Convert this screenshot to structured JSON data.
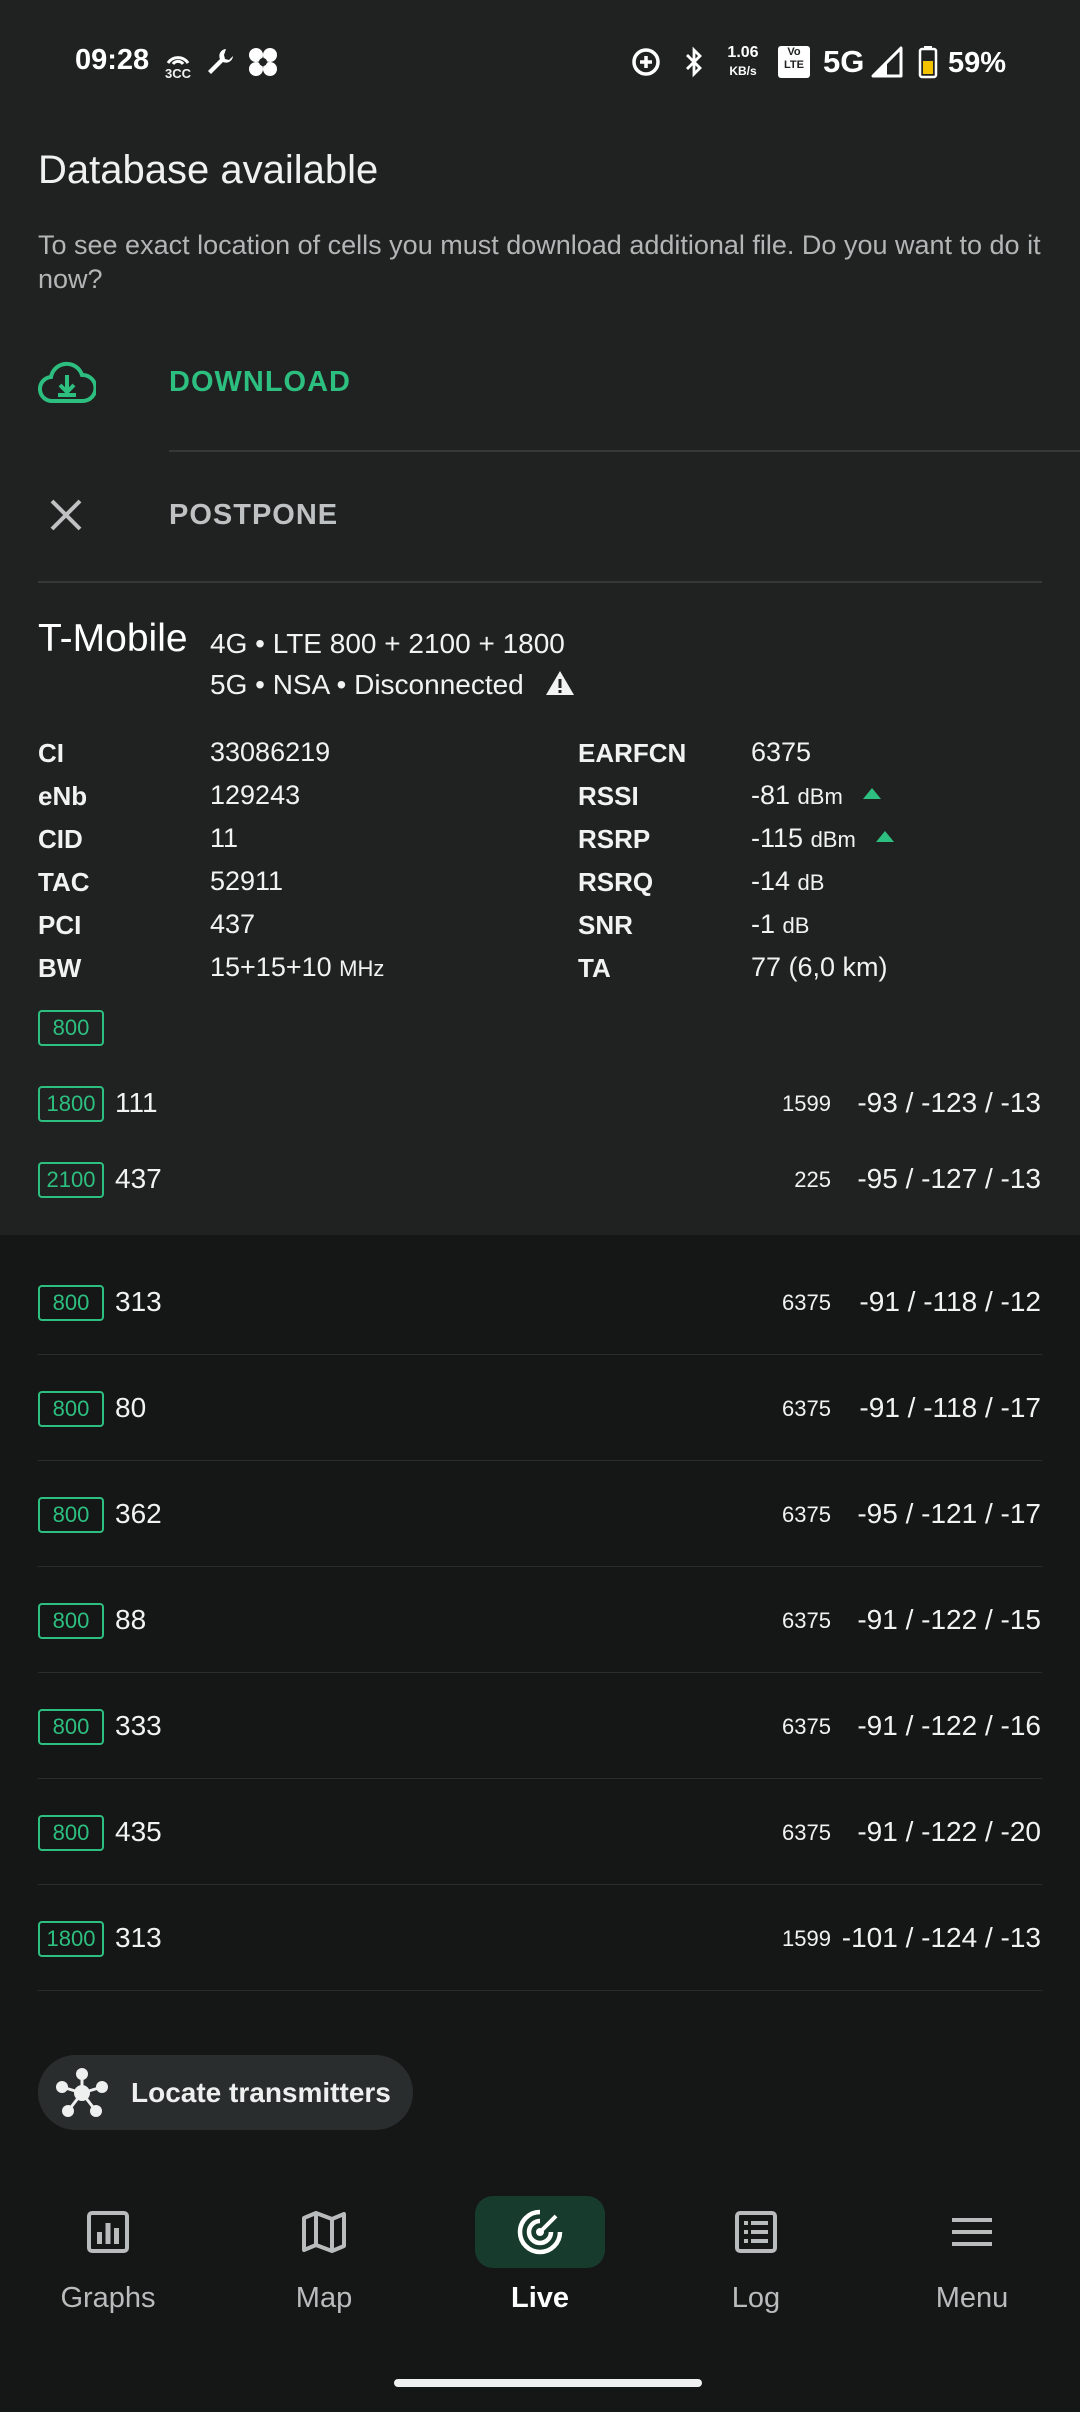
{
  "status_bar": {
    "time": "09:28",
    "notif_badge": "3CC",
    "net_speed_value": "1.06",
    "net_speed_unit": "KB/s",
    "volte_top": "Vo",
    "volte_bottom": "LTE",
    "network_type": "5G",
    "battery": "59%",
    "left_icons": [
      "radio-signal-icon",
      "wrench-icon",
      "fan-icon"
    ],
    "right_icons": [
      "data-saver-icon",
      "bluetooth-icon",
      "signal-icon",
      "battery-icon"
    ]
  },
  "dialog": {
    "title": "Database available",
    "message": "To see exact location of cells you must download additional file. Do you want to do it now?",
    "download_label": "DOWNLOAD",
    "postpone_label": "POSTPONE"
  },
  "operator": {
    "name": "T-Mobile",
    "line1": "4G • LTE 800 + 2100 + 1800",
    "line2": "5G • NSA • Disconnected"
  },
  "params_left": [
    {
      "label": "CI",
      "value": "33086219",
      "unit": ""
    },
    {
      "label": "eNb",
      "value": "129243",
      "unit": ""
    },
    {
      "label": "CID",
      "value": "11",
      "unit": ""
    },
    {
      "label": "TAC",
      "value": "52911",
      "unit": ""
    },
    {
      "label": "PCI",
      "value": "437",
      "unit": ""
    },
    {
      "label": "BW",
      "value": "15+15+10",
      "unit": "MHz"
    }
  ],
  "params_right": [
    {
      "label": "EARFCN",
      "value": "6375",
      "unit": ""
    },
    {
      "label": "RSSI",
      "value": "-81",
      "unit": "dBm"
    },
    {
      "label": "RSRP",
      "value": "-115",
      "unit": "dBm"
    },
    {
      "label": "RSRQ",
      "value": "-14",
      "unit": "dB"
    },
    {
      "label": "SNR",
      "value": "-1",
      "unit": "dB"
    },
    {
      "label": "TA",
      "value": "77 (6,0 km)",
      "unit": ""
    }
  ],
  "primary_band": "800",
  "serving_cells": [
    {
      "band": "1800",
      "pci": "111",
      "arfcn": "1599",
      "signal": "-93 / -123 / -13"
    },
    {
      "band": "2100",
      "pci": "437",
      "arfcn": "225",
      "signal": "-95 / -127 / -13"
    }
  ],
  "neighbor_cells": [
    {
      "band": "800",
      "pci": "313",
      "arfcn": "6375",
      "signal": "-91 / -118 / -12"
    },
    {
      "band": "800",
      "pci": "80",
      "arfcn": "6375",
      "signal": "-91 / -118 / -17"
    },
    {
      "band": "800",
      "pci": "362",
      "arfcn": "6375",
      "signal": "-95 / -121 / -17"
    },
    {
      "band": "800",
      "pci": "88",
      "arfcn": "6375",
      "signal": "-91 / -122 / -15"
    },
    {
      "band": "800",
      "pci": "333",
      "arfcn": "6375",
      "signal": "-91 / -122 / -16"
    },
    {
      "band": "800",
      "pci": "435",
      "arfcn": "6375",
      "signal": "-91 / -122 / -20"
    },
    {
      "band": "1800",
      "pci": "313",
      "arfcn": "1599",
      "signal": "-101 / -124 / -13"
    }
  ],
  "locate_label": "Locate transmitters",
  "nav": [
    {
      "label": "Graphs",
      "icon": "graphs-icon"
    },
    {
      "label": "Map",
      "icon": "map-icon"
    },
    {
      "label": "Live",
      "icon": "live-icon",
      "active": true
    },
    {
      "label": "Log",
      "icon": "log-icon"
    },
    {
      "label": "Menu",
      "icon": "menu-icon"
    }
  ],
  "colors": {
    "accent": "#2dbf7f",
    "background": "#151717",
    "panel": "#202222"
  }
}
